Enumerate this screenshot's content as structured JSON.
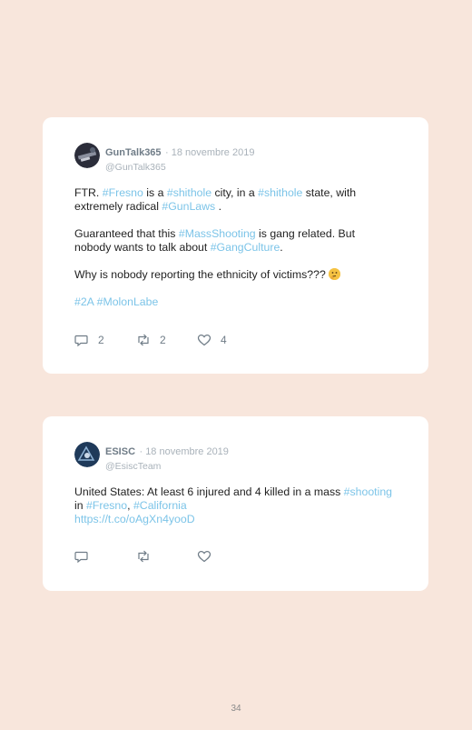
{
  "tweets": [
    {
      "name": "GunTalk365",
      "date": "· 18 novembre 2019",
      "handle": "@GunTalk365",
      "p1": {
        "t1": "FTR. ",
        "h1": "#Fresno",
        "t2": " is a ",
        "h2": "#shithole",
        "t3": " city, in a ",
        "h3": "#shithole",
        "t4": " state, with extremely radical ",
        "h4": "#GunLaws",
        "t5": " ."
      },
      "p2": {
        "t1": "Guaranteed that this ",
        "h1": "#MassShooting",
        "t2": " is gang related. But nobody wants to talk about ",
        "h2": "#GangCulture",
        "t3": "."
      },
      "p3": {
        "t1": "Why is nobody reporting the ethnicity of victims??? ",
        "emoji": "thinking-face-emoji"
      },
      "p4": {
        "h1": "#2A",
        "h2": "#MolonLabe"
      },
      "replies": "2",
      "retweets": "2",
      "likes": "4"
    },
    {
      "name": "ESISC",
      "date": "· 18 novembre 2019",
      "handle": "@EsiscTeam",
      "p1": {
        "t1": "United States: At least 6 injured and 4 killed in a mass ",
        "h1": "#shooting",
        "t2": " in ",
        "h2": "#Fresno",
        "t3": ", ",
        "h3": "#California",
        "link": "https://t.co/oAgXn4yooD"
      }
    }
  ],
  "icons": {
    "reply": "reply-icon",
    "retweet": "retweet-icon",
    "like": "heart-icon"
  },
  "colors": {
    "background": "#f8e6dc",
    "hashtag": "#7cc4e8",
    "meta": "#a9b2ba"
  },
  "page_number": "34"
}
